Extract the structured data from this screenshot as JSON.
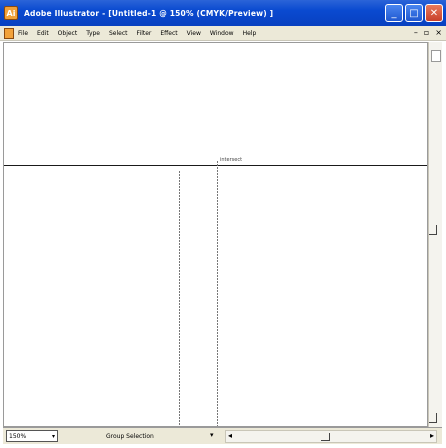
{
  "window": {
    "title": "Adobe Illustrator - [Untitled-1 @ 150% (CMYK/Preview) ]",
    "app_icon": "Ai"
  },
  "menubar": {
    "items": [
      "File",
      "Edit",
      "Object",
      "Type",
      "Select",
      "Filter",
      "Effect",
      "View",
      "Window",
      "Help"
    ]
  },
  "canvas": {
    "guide_label": "intersect"
  },
  "statusbar": {
    "zoom": "150%",
    "tool": "Group Selection"
  },
  "icons": {
    "minimize": "minimize-icon",
    "maximize": "maximize-icon",
    "close": "close-icon"
  }
}
